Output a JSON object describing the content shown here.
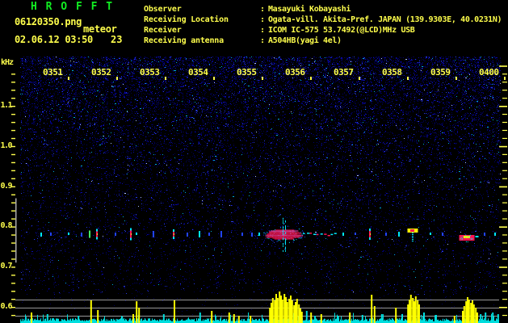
{
  "window": {
    "app_title": "H R O F F T"
  },
  "header": {
    "filename": "06120350.png",
    "mode_label": "meteor",
    "datetime": "02.06.12 03:50",
    "meteor_count": "23",
    "separator": ":",
    "rows": [
      {
        "label": "Observer",
        "value": "Masayuki Kobayashi"
      },
      {
        "label": "Receiving Location",
        "value": "Ogata-vill. Akita-Pref. JAPAN (139.9303E, 40.0231N)"
      },
      {
        "label": "Receiver",
        "value": "ICOM IC-575 53.7492(@LCD)MHz USB"
      },
      {
        "label": "Receiving antenna",
        "value": "A504HB(yagi 4el)"
      }
    ]
  },
  "colors": {
    "accent_yellow": "#ffff4c",
    "title_green": "#11ee22",
    "signal_yellow": "#ffff00",
    "signal_cyan": "#00dede",
    "grid_gray": "#989898",
    "echo_red": "#ff1450",
    "echo_magenta": "#ff44aa",
    "echo_cyan": "#00e8ff",
    "echo_blue": "#2244ff",
    "echo_green": "#44ff66",
    "noise_dark_blue": "#000060"
  },
  "chart_data": {
    "type": "heatmap",
    "title": "HROFFT meteor-echo spectrogram 0350-0400",
    "ylabel": "kHz",
    "x_ticks": [
      "0351",
      "0352",
      "0353",
      "0354",
      "0355",
      "0356",
      "0357",
      "0358",
      "0359",
      "0400"
    ],
    "y_ticks": [
      "1.1",
      "1.0",
      "0.9",
      "0.8",
      "0.7",
      "0.6"
    ],
    "y_tick_khz": [
      1.1,
      1.0,
      0.9,
      0.8,
      0.7,
      0.6
    ],
    "freq_axis_khz": [
      0.58,
      1.22
    ],
    "time_axis_min": [
      0,
      10
    ],
    "minor_tick_khz": 0.02,
    "echo_band_khz": 0.78,
    "detect_marker_khz": [
      0.71,
      0.87
    ],
    "echoes": [
      {
        "t": 0.45,
        "kind": "dot",
        "c": "cyan"
      },
      {
        "t": 0.65,
        "kind": "dot",
        "c": "blue"
      },
      {
        "t": 1.02,
        "kind": "dot",
        "c": "cyan"
      },
      {
        "t": 1.28,
        "kind": "dot",
        "c": "blue"
      },
      {
        "t": 1.45,
        "kind": "streak",
        "c": "green",
        "h": 9
      },
      {
        "t": 1.6,
        "kind": "streak",
        "c": "red",
        "h": 13
      },
      {
        "t": 1.98,
        "kind": "dot",
        "c": "blue"
      },
      {
        "t": 2.3,
        "kind": "streak",
        "c": "red",
        "h": 15
      },
      {
        "t": 2.42,
        "kind": "dot",
        "c": "cyan"
      },
      {
        "t": 2.77,
        "kind": "streak",
        "c": "blue",
        "h": 8
      },
      {
        "t": 3.18,
        "kind": "streak",
        "c": "red",
        "h": 12
      },
      {
        "t": 3.47,
        "kind": "dot",
        "c": "blue"
      },
      {
        "t": 3.72,
        "kind": "streak",
        "c": "cyan",
        "h": 8
      },
      {
        "t": 3.92,
        "kind": "dot",
        "c": "blue"
      },
      {
        "t": 4.17,
        "kind": "streak",
        "c": "blue",
        "h": 8
      },
      {
        "t": 4.6,
        "kind": "dot",
        "c": "blue"
      },
      {
        "t": 4.8,
        "kind": "dot",
        "c": "blue"
      },
      {
        "t": 4.95,
        "kind": "dot",
        "c": "cyan"
      },
      {
        "t": 5.45,
        "kind": "blob",
        "w": 44,
        "h": 13,
        "vspread": 46,
        "trail": 42
      },
      {
        "t": 6.68,
        "kind": "dot",
        "c": "cyan"
      },
      {
        "t": 6.93,
        "kind": "dot",
        "c": "blue"
      },
      {
        "t": 7.23,
        "kind": "streak",
        "c": "red",
        "h": 14
      },
      {
        "t": 7.57,
        "kind": "dot",
        "c": "blue"
      },
      {
        "t": 7.83,
        "kind": "streak",
        "c": "cyan",
        "h": 6
      },
      {
        "t": 8.12,
        "kind": "mushroom",
        "w": 13,
        "stem": 12
      },
      {
        "t": 8.48,
        "kind": "dot",
        "c": "cyan"
      },
      {
        "t": 8.73,
        "kind": "dot",
        "c": "blue"
      },
      {
        "t": 9.23,
        "kind": "redblob",
        "w": 19,
        "h": 7
      },
      {
        "t": 9.6,
        "kind": "dot",
        "c": "blue"
      },
      {
        "t": 9.82,
        "kind": "dot",
        "c": "cyan"
      }
    ],
    "signal_graph": {
      "gridlines_y": [
        371,
        381,
        391
      ],
      "yellow_spikes": [
        [
          0.25,
          12
        ],
        [
          1.48,
          27
        ],
        [
          1.62,
          15
        ],
        [
          2.35,
          10
        ],
        [
          2.42,
          26
        ],
        [
          2.47,
          18
        ],
        [
          3.2,
          27
        ],
        [
          3.97,
          14
        ],
        [
          4.33,
          12
        ],
        [
          4.43,
          10
        ],
        [
          4.53,
          8
        ],
        [
          4.77,
          8
        ],
        [
          5.17,
          18
        ],
        [
          5.2,
          24
        ],
        [
          5.23,
          30
        ],
        [
          5.27,
          27
        ],
        [
          5.3,
          35
        ],
        [
          5.33,
          30
        ],
        [
          5.37,
          38
        ],
        [
          5.4,
          33
        ],
        [
          5.43,
          28
        ],
        [
          5.47,
          35
        ],
        [
          5.5,
          31
        ],
        [
          5.53,
          25
        ],
        [
          5.57,
          29
        ],
        [
          5.6,
          33
        ],
        [
          5.63,
          27
        ],
        [
          5.67,
          21
        ],
        [
          5.7,
          25
        ],
        [
          5.73,
          29
        ],
        [
          5.77,
          22
        ],
        [
          5.8,
          17
        ],
        [
          5.83,
          13
        ],
        [
          6.02,
          12
        ],
        [
          6.23,
          10
        ],
        [
          6.82,
          12
        ],
        [
          7.27,
          34
        ],
        [
          7.33,
          20
        ],
        [
          7.77,
          18
        ],
        [
          8.02,
          22
        ],
        [
          8.05,
          28
        ],
        [
          8.08,
          34
        ],
        [
          8.12,
          30
        ],
        [
          8.15,
          26
        ],
        [
          8.18,
          32
        ],
        [
          8.22,
          27
        ],
        [
          8.25,
          22
        ],
        [
          8.98,
          8
        ],
        [
          9.15,
          14
        ],
        [
          9.18,
          20
        ],
        [
          9.22,
          26
        ],
        [
          9.25,
          31
        ],
        [
          9.28,
          28
        ],
        [
          9.32,
          24
        ],
        [
          9.35,
          27
        ],
        [
          9.38,
          22
        ],
        [
          9.42,
          18
        ],
        [
          9.45,
          12
        ]
      ],
      "cyan_spikes": [
        [
          0.58,
          10
        ],
        [
          1.22,
          8
        ],
        [
          2.12,
          7
        ],
        [
          2.98,
          10
        ],
        [
          3.73,
          12
        ],
        [
          4.05,
          8
        ],
        [
          5.93,
          14
        ],
        [
          6.1,
          8
        ],
        [
          6.58,
          8
        ],
        [
          7.08,
          9
        ],
        [
          7.48,
          10
        ],
        [
          7.9,
          10
        ],
        [
          8.35,
          12
        ],
        [
          8.6,
          9
        ],
        [
          9.52,
          10
        ],
        [
          9.62,
          12
        ],
        [
          9.77,
          12
        ],
        [
          9.88,
          10
        ]
      ]
    }
  }
}
